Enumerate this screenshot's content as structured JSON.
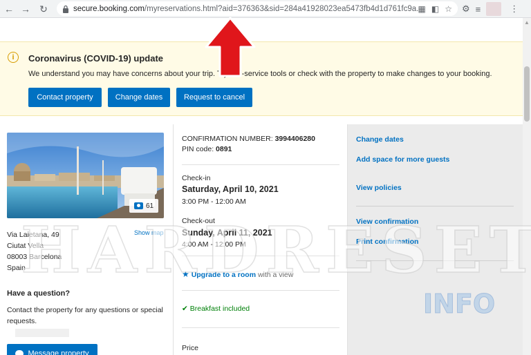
{
  "browser": {
    "url_host": "secure.booking.com",
    "url_path": "/myreservations.html?aid=376363&sid=284a41928023ea5473fb4d1d761fc9a..."
  },
  "banner": {
    "title": "Coronavirus (COVID-19) update",
    "text": "We understand you may have concerns about your trip. Try self-service tools or check with the property to make changes to your booking.",
    "buttons": [
      "Contact property",
      "Change dates",
      "Request to cancel"
    ]
  },
  "property": {
    "photo_count": "61",
    "address": [
      "Via Laietana, 49",
      "Ciutat Vella",
      "08003 Barcelona",
      "Spain"
    ],
    "show_map": "Show map",
    "question_title": "Have a question?",
    "question_text": "Contact the property for any questions or special requests.",
    "message_button": "Message property"
  },
  "booking": {
    "confirmation_label": "CONFIRMATION NUMBER:",
    "confirmation_number": "3994406280",
    "pin_label": "PIN code:",
    "pin": "0891",
    "checkin_label": "Check-in",
    "checkin_date": "Saturday, April 10, 2021",
    "checkin_time": "3:00 PM - 12:00 AM",
    "checkout_label": "Check-out",
    "checkout_date": "Sunday, April 11, 2021",
    "checkout_time": "4:00 AM - 12:00 PM",
    "upgrade_link": "Upgrade to a room",
    "upgrade_suffix": "with a view",
    "breakfast": "Breakfast included",
    "price_label": "Price"
  },
  "actions": {
    "change_dates": "Change dates",
    "add_space": "Add space for more guests",
    "view_policies": "View policies",
    "view_confirmation": "View confirmation",
    "print_confirmation": "Print confirmation"
  },
  "watermark": {
    "main": "HARDRESET",
    "sub": "INFO"
  },
  "colors": {
    "brand_blue": "#0071c2",
    "banner_bg": "#fffbe6",
    "success_green": "#008009",
    "arrow_red": "#e0161b"
  },
  "icons": [
    "back-icon",
    "forward-icon",
    "reload-icon",
    "lock-icon",
    "info-icon",
    "camera-icon",
    "star-icon",
    "check-icon",
    "chat-icon"
  ]
}
